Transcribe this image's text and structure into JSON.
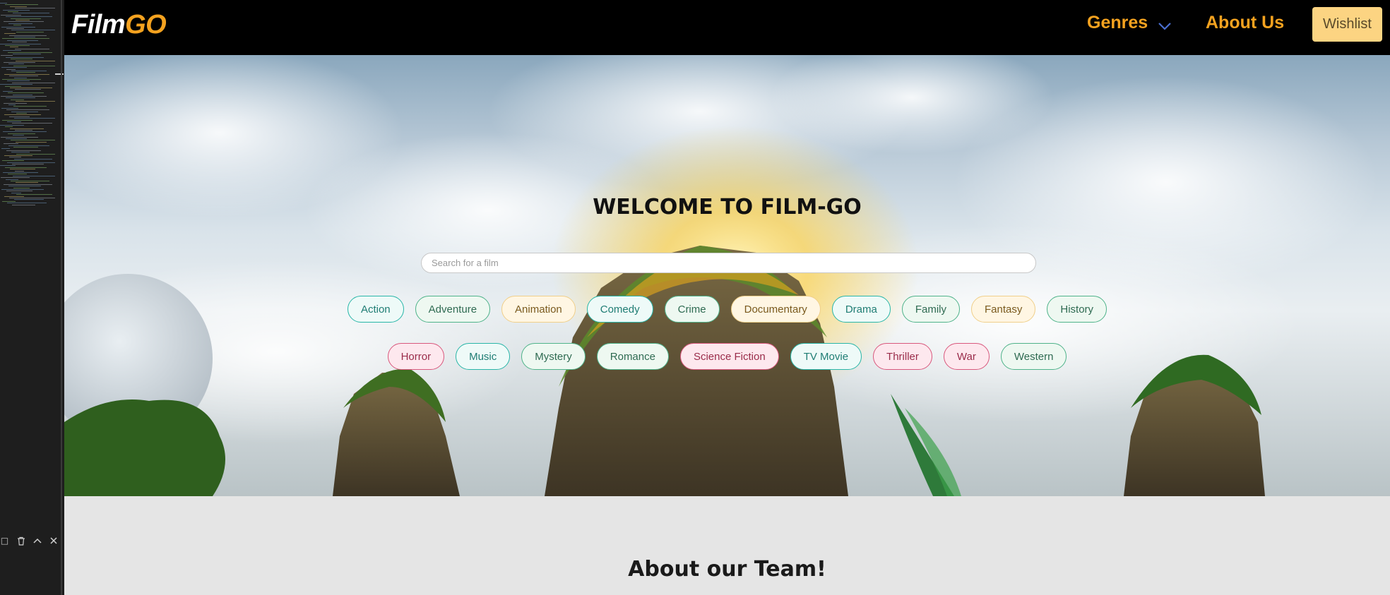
{
  "brand": {
    "logo_part1": "Film",
    "logo_part2": "GO",
    "accent_color": "#f4a21f"
  },
  "nav": {
    "genres_label": "Genres",
    "about_label": "About Us",
    "wishlist_label": "Wishlist"
  },
  "hero": {
    "title": "WELCOME TO FILM-GO",
    "search_placeholder": "Search for a film",
    "genres_row1": [
      {
        "label": "Action",
        "style": "teal"
      },
      {
        "label": "Adventure",
        "style": "green"
      },
      {
        "label": "Animation",
        "style": "cream"
      },
      {
        "label": "Comedy",
        "style": "teal"
      },
      {
        "label": "Crime",
        "style": "green"
      },
      {
        "label": "Documentary",
        "style": "cream"
      },
      {
        "label": "Drama",
        "style": "teal"
      },
      {
        "label": "Family",
        "style": "green"
      },
      {
        "label": "Fantasy",
        "style": "cream"
      },
      {
        "label": "History",
        "style": "green"
      }
    ],
    "genres_row2": [
      {
        "label": "Horror",
        "style": "pink"
      },
      {
        "label": "Music",
        "style": "teal"
      },
      {
        "label": "Mystery",
        "style": "green"
      },
      {
        "label": "Romance",
        "style": "green"
      },
      {
        "label": "Science Fiction",
        "style": "pink"
      },
      {
        "label": "TV Movie",
        "style": "teal"
      },
      {
        "label": "Thriller",
        "style": "pink"
      },
      {
        "label": "War",
        "style": "pink"
      },
      {
        "label": "Western",
        "style": "green"
      }
    ]
  },
  "about": {
    "title": "About our Team!"
  },
  "editor_tools": [
    "panel-icon",
    "trash-icon",
    "chevron-up-icon",
    "close-icon"
  ]
}
